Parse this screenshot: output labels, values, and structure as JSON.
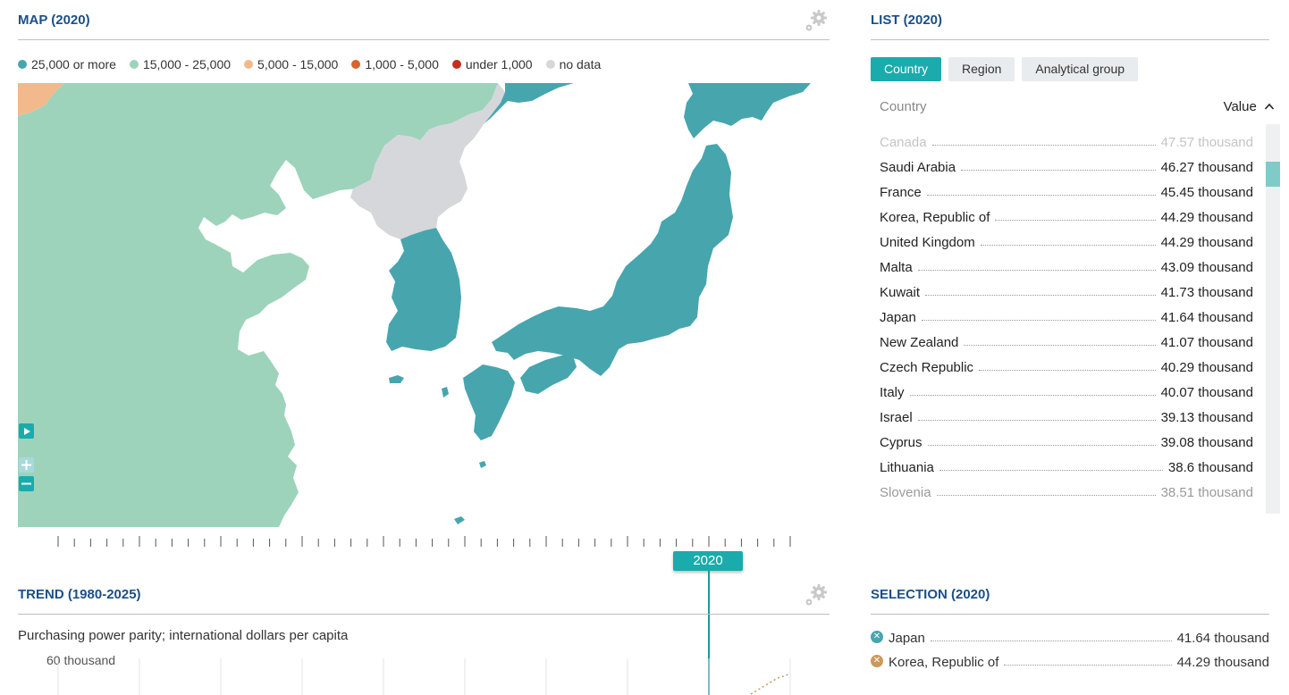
{
  "map_panel": {
    "title": "MAP (2020)"
  },
  "legend": [
    {
      "label": "25,000 or more",
      "color": "#47a5ae"
    },
    {
      "label": "15,000 - 25,000",
      "color": "#9dd3bb"
    },
    {
      "label": "5,000 - 15,000",
      "color": "#f2b98c"
    },
    {
      "label": "1,000 - 5,000",
      "color": "#d9632a"
    },
    {
      "label": "under 1,000",
      "color": "#c0301e"
    },
    {
      "label": "no data",
      "color": "#d6d7da"
    }
  ],
  "timeline": {
    "selected_year": "2020"
  },
  "trend_panel": {
    "title": "TREND (1980-2025)",
    "unit": "Purchasing power parity; international dollars per capita",
    "y_tick": "60 thousand"
  },
  "list_panel": {
    "title": "LIST (2020)",
    "tabs": [
      "Country",
      "Region",
      "Analytical group"
    ],
    "col_country": "Country",
    "col_value": "Value",
    "rows": [
      {
        "name": "Canada",
        "value": "47.57 thousand"
      },
      {
        "name": "Saudi Arabia",
        "value": "46.27 thousand"
      },
      {
        "name": "France",
        "value": "45.45 thousand"
      },
      {
        "name": "Korea, Republic of",
        "value": "44.29 thousand"
      },
      {
        "name": "United Kingdom",
        "value": "44.29 thousand"
      },
      {
        "name": "Malta",
        "value": "43.09 thousand"
      },
      {
        "name": "Kuwait",
        "value": "41.73 thousand"
      },
      {
        "name": "Japan",
        "value": "41.64 thousand"
      },
      {
        "name": "New Zealand",
        "value": "41.07 thousand"
      },
      {
        "name": "Czech Republic",
        "value": "40.29 thousand"
      },
      {
        "name": "Italy",
        "value": "40.07 thousand"
      },
      {
        "name": "Israel",
        "value": "39.13 thousand"
      },
      {
        "name": "Cyprus",
        "value": "39.08 thousand"
      },
      {
        "name": "Lithuania",
        "value": "38.6 thousand"
      },
      {
        "name": "Slovenia",
        "value": "38.51 thousand"
      }
    ]
  },
  "selection_panel": {
    "title": "SELECTION (2020)",
    "items": [
      {
        "name": "Japan",
        "value": "41.64 thousand",
        "color": "#47a5ae"
      },
      {
        "name": "Korea, Republic of",
        "value": "44.29 thousand",
        "color": "#c99a5b"
      }
    ]
  },
  "icons": {
    "settings": "gear-icon",
    "play": "play-icon",
    "zoom_in": "plus-icon",
    "zoom_out": "minus-icon",
    "sort": "chevron-up-icon",
    "remove": "close-icon"
  }
}
